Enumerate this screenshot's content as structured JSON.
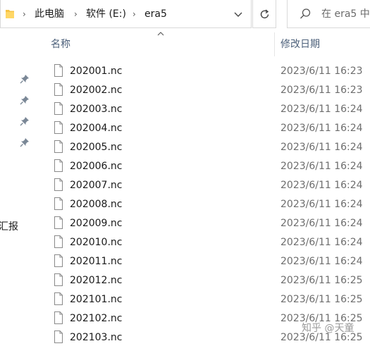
{
  "address_bar": {
    "separator": "›",
    "breadcrumbs": [
      "此电脑",
      "软件 (E:)",
      "era5"
    ]
  },
  "search": {
    "placeholder": "在 era5 中"
  },
  "sidebar": {
    "partial_label": "汇报"
  },
  "columns": {
    "name": "名称",
    "date_modified": "修改日期"
  },
  "files": [
    {
      "name": "202001.nc",
      "modified": "2023/6/11 16:23"
    },
    {
      "name": "202002.nc",
      "modified": "2023/6/11 16:23"
    },
    {
      "name": "202003.nc",
      "modified": "2023/6/11 16:24"
    },
    {
      "name": "202004.nc",
      "modified": "2023/6/11 16:24"
    },
    {
      "name": "202005.nc",
      "modified": "2023/6/11 16:24"
    },
    {
      "name": "202006.nc",
      "modified": "2023/6/11 16:24"
    },
    {
      "name": "202007.nc",
      "modified": "2023/6/11 16:24"
    },
    {
      "name": "202008.nc",
      "modified": "2023/6/11 16:24"
    },
    {
      "name": "202009.nc",
      "modified": "2023/6/11 16:24"
    },
    {
      "name": "202010.nc",
      "modified": "2023/6/11 16:24"
    },
    {
      "name": "202011.nc",
      "modified": "2023/6/11 16:24"
    },
    {
      "name": "202012.nc",
      "modified": "2023/6/11 16:25"
    },
    {
      "name": "202101.nc",
      "modified": "2023/6/11 16:25"
    },
    {
      "name": "202102.nc",
      "modified": "2023/6/11 16:25"
    },
    {
      "name": "202103.nc",
      "modified": "2023/6/11 16:25"
    }
  ],
  "watermark": "知乎 @天童",
  "icons": {
    "folder": "folder-icon",
    "file": "file-icon",
    "pin": "pin-icon",
    "search": "search-icon",
    "refresh": "refresh-icon",
    "dropdown": "chevron-down-icon"
  },
  "colors": {
    "folder": "#f6c343",
    "header_text": "#4c607a",
    "date_text": "#6d6d6d",
    "border": "#d9d9d9"
  }
}
